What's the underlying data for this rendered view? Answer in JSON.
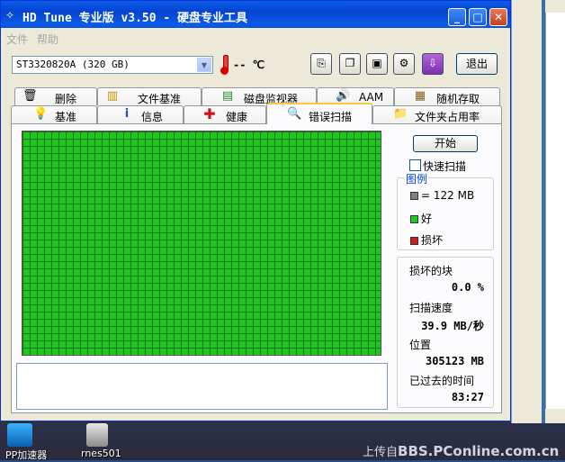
{
  "window": {
    "title": "HD Tune 专业版 v3.50 - 硬盘专业工具",
    "min_symbol": "_",
    "max_symbol": "□",
    "close_symbol": "✕"
  },
  "menu": [
    "文件",
    "帮助"
  ],
  "toolbar": {
    "drive": "ST3320820A (320 GB)",
    "temperature": "-- ℃",
    "exit_label": "退出",
    "tool_icons": [
      "copy-icon",
      "copy-screen-icon",
      "save-icon",
      "options-icon",
      "download-icon"
    ]
  },
  "tabs_back": [
    {
      "label": "删除",
      "icon": "trash-icon"
    },
    {
      "label": "文件基准",
      "icon": "file-benchmark-icon"
    },
    {
      "label": "磁盘监视器",
      "icon": "disk-monitor-icon"
    },
    {
      "label": "AAM",
      "icon": "speaker-icon"
    },
    {
      "label": "随机存取",
      "icon": "random-access-icon"
    }
  ],
  "tabs_front": [
    {
      "label": "基准",
      "icon": "benchmark-icon"
    },
    {
      "label": "信息",
      "icon": "info-icon"
    },
    {
      "label": "健康",
      "icon": "health-icon"
    },
    {
      "label": "错误扫描",
      "icon": "search-icon",
      "active": true
    },
    {
      "label": "文件夹占用率",
      "icon": "folder-icon"
    }
  ],
  "scan": {
    "start_label": "开始",
    "quick_scan_label": "快速扫描",
    "quick_scan_checked": false,
    "legend_title": "图例",
    "legend_block": "= 122 MB",
    "legend_good": "好",
    "legend_bad": "损坏",
    "colors": {
      "block": "#808080",
      "good": "#1ec81e",
      "bad": "#c81e1e"
    }
  },
  "stats": {
    "bad_blocks_label": "损坏的块",
    "bad_blocks_value": "0.0 %",
    "speed_label": "扫描速度",
    "speed_value": "39.9 MB/秒",
    "position_label": "位置",
    "position_value": "305123 MB",
    "elapsed_label": "已过去的时间",
    "elapsed_value": "83:27"
  },
  "desktop": {
    "icons": [
      "PP加速器",
      "rnes501"
    ],
    "watermark_prefix": "上传自",
    "watermark_site": "BBS.PConline.com.cn"
  }
}
